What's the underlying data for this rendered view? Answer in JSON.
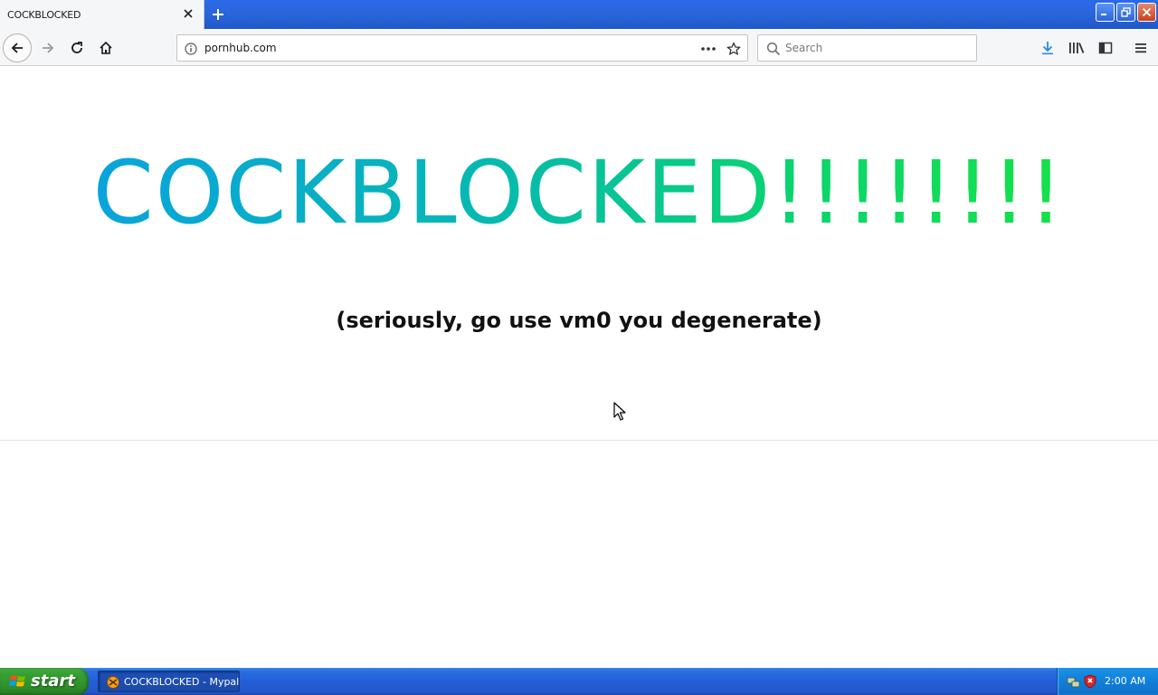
{
  "browser": {
    "tab": {
      "title": "COCKBLOCKED"
    },
    "url": "pornhub.com",
    "search": {
      "placeholder": "Search",
      "value": ""
    }
  },
  "page": {
    "headline": "COCKBLOCKED!!!!!!!!",
    "subline": "(seriously, go use vm0 you degenerate)"
  },
  "taskbar": {
    "start_label": "start",
    "task_label": "COCKBLOCKED - Mypal",
    "clock": "2:00 AM"
  },
  "colors": {
    "headline_gradient": [
      "#0a9fe6",
      "#06b7b5",
      "#0bd56c",
      "#18e63c"
    ],
    "titlebar": "#2a64d9",
    "start_green": "#36a134"
  },
  "icons": {
    "tab_close": "close-icon",
    "new_tab": "plus-icon",
    "back": "arrow-left-icon",
    "forward": "arrow-right-icon",
    "reload": "reload-icon",
    "home": "home-icon",
    "site_info": "info-icon",
    "page_actions": "more-horizontal-icon",
    "bookmark": "star-icon",
    "search": "search-icon",
    "downloads": "download-icon",
    "library": "library-icon",
    "sidebar": "sidebar-icon",
    "menu": "hamburger-menu-icon"
  }
}
